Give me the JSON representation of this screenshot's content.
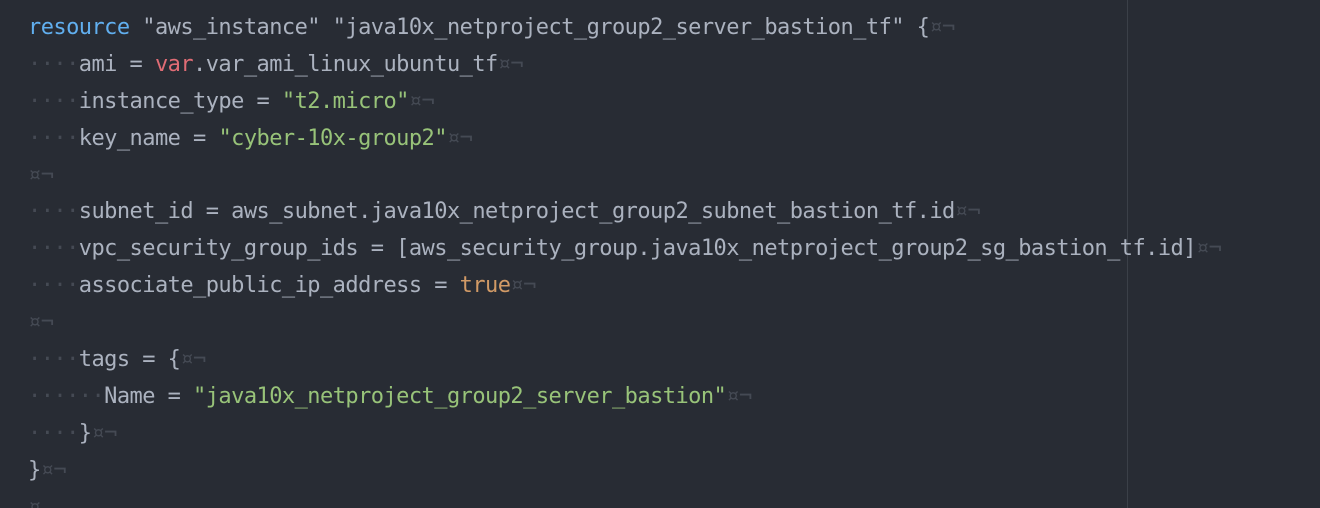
{
  "editor": {
    "lines": [
      [
        {
          "t": "kw",
          "v": "resource"
        },
        {
          "t": "plain",
          "v": " \"aws_instance\" \"java10x_netproject_group2_server_bastion_tf\" {"
        },
        {
          "t": "ws",
          "v": "¤¬"
        }
      ],
      [
        {
          "t": "ws",
          "v": "····"
        },
        {
          "t": "plain",
          "v": "ami = "
        },
        {
          "t": "var",
          "v": "var"
        },
        {
          "t": "plain",
          "v": ".var_ami_linux_ubuntu_tf"
        },
        {
          "t": "ws",
          "v": "¤¬"
        }
      ],
      [
        {
          "t": "ws",
          "v": "····"
        },
        {
          "t": "plain",
          "v": "instance_type = "
        },
        {
          "t": "str",
          "v": "\"t2.micro\""
        },
        {
          "t": "ws",
          "v": "¤¬"
        }
      ],
      [
        {
          "t": "ws",
          "v": "····"
        },
        {
          "t": "plain",
          "v": "key_name = "
        },
        {
          "t": "str",
          "v": "\"cyber-10x-group2\""
        },
        {
          "t": "ws",
          "v": "¤¬"
        }
      ],
      [
        {
          "t": "ws",
          "v": "¤¬"
        }
      ],
      [
        {
          "t": "ws",
          "v": "····"
        },
        {
          "t": "plain",
          "v": "subnet_id = aws_subnet.java10x_netproject_group2_subnet_bastion_tf.id"
        },
        {
          "t": "ws",
          "v": "¤¬"
        }
      ],
      [
        {
          "t": "ws",
          "v": "····"
        },
        {
          "t": "plain",
          "v": "vpc_security_group_ids = [aws_security_group.java10x_netproject_group2_sg_bastion_tf.id]"
        },
        {
          "t": "ws",
          "v": "¤¬"
        }
      ],
      [
        {
          "t": "ws",
          "v": "····"
        },
        {
          "t": "plain",
          "v": "associate_public_ip_address = "
        },
        {
          "t": "bool",
          "v": "true"
        },
        {
          "t": "ws",
          "v": "¤¬"
        }
      ],
      [
        {
          "t": "ws",
          "v": "¤¬"
        }
      ],
      [
        {
          "t": "ws",
          "v": "····"
        },
        {
          "t": "plain",
          "v": "tags = {"
        },
        {
          "t": "ws",
          "v": "¤¬"
        }
      ],
      [
        {
          "t": "ws",
          "v": "······"
        },
        {
          "t": "plain",
          "v": "Name = "
        },
        {
          "t": "str",
          "v": "\"java10x_netproject_group2_server_bastion\""
        },
        {
          "t": "ws",
          "v": "¤¬"
        }
      ],
      [
        {
          "t": "ws",
          "v": "····"
        },
        {
          "t": "plain",
          "v": "}"
        },
        {
          "t": "ws",
          "v": "¤¬"
        }
      ],
      [
        {
          "t": "plain",
          "v": "}"
        },
        {
          "t": "ws",
          "v": "¤¬"
        }
      ],
      [
        {
          "t": "ws",
          "v": "¤"
        }
      ]
    ]
  },
  "colors": {
    "background": "#282c34",
    "keyword": "#61afef",
    "variable": "#e06c75",
    "string": "#98c379",
    "boolean": "#d19a66",
    "text": "#abb2bf",
    "invisibles": "#454a54"
  }
}
